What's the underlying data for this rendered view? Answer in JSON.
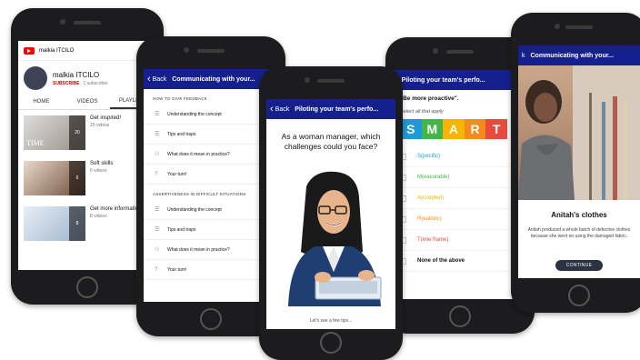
{
  "colors": {
    "nav_blue": "#15208e",
    "youtube_red": "#ff0000",
    "continue_button": "#2b3241",
    "smart_s": "#1e9ad6",
    "smart_m": "#43b649",
    "smart_a": "#f7b400",
    "smart_r": "#f28b1b",
    "smart_t": "#e84b3c"
  },
  "youtube": {
    "channel_name_top": "malkia ITCILO",
    "channel_name": "malkia ITCILO",
    "subscribe_label": "SUBSCRIBE",
    "subscriber_count": "1 subscriber",
    "tabs": [
      "HOME",
      "VIDEOS",
      "PLAYLISTS"
    ],
    "playlists": [
      {
        "title": "Get inspired!",
        "meta": "20 videos",
        "count": "20"
      },
      {
        "title": "Soft skills",
        "meta": "6 videos",
        "count": "6"
      },
      {
        "title": "Get more informatio",
        "meta": "8 videos",
        "count": "8"
      }
    ],
    "thumb_caption": "TIME",
    "search_icon": "search-icon"
  },
  "feedback": {
    "back_label": "Back",
    "title": "Communicating with your...",
    "section1": "HOW TO GIVE FEEDBACK",
    "section1_items": [
      {
        "icon": "list-icon",
        "label": "Understanding the concept"
      },
      {
        "icon": "list-icon",
        "label": "Tips and traps"
      },
      {
        "icon": "people-icon",
        "label": "What does it mean in practice?"
      },
      {
        "icon": "question-icon",
        "label": "Your turn!"
      }
    ],
    "section2": "ASSERTIVENESS IN DIFFICULT SITUATIONS",
    "section2_items": [
      {
        "icon": "list-icon",
        "label": "Understanding the concept"
      },
      {
        "icon": "list-icon",
        "label": "Tips and traps"
      },
      {
        "icon": "people-icon",
        "label": "What does it mean in practice?"
      },
      {
        "icon": "question-icon",
        "label": "Your turn!"
      }
    ]
  },
  "center": {
    "back_label": "Back",
    "title": "Piloting your team's perfo...",
    "question": "As a woman manager, which challenges could you face?",
    "footer": "Let's see a few tips..."
  },
  "smart": {
    "title": "Piloting your team's perfo...",
    "quote": "\"Be more proactive\".",
    "instruction": "Select all that apply",
    "letters": [
      "S",
      "M",
      "A",
      "R",
      "T"
    ],
    "options": [
      {
        "label": "S(pecific)",
        "color": "#1e9ad6"
      },
      {
        "label": "M(easurable)",
        "color": "#43b649"
      },
      {
        "label": "A(ccepted)",
        "color": "#e8b400"
      },
      {
        "label": "R(ealistic)",
        "color": "#f28b1b"
      },
      {
        "label": "T(ime frame)",
        "color": "#e84b3c"
      },
      {
        "label": "None of the above",
        "color": "#111111"
      }
    ]
  },
  "anitah": {
    "title_fragment": "Communicating with your...",
    "back_fragment": "k",
    "card_title": "Anitah's clothes",
    "card_text": "Anitah produced a whole batch of defective clothes because she went on using the damaged fabric.",
    "button": "CONTINUE"
  }
}
